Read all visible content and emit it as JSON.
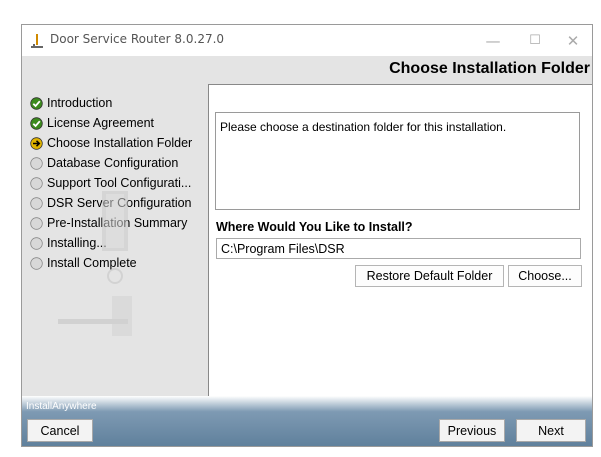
{
  "window": {
    "title": "Door Service Router 8.0.27.0",
    "controls": {
      "minimize": "—",
      "maximize": "☐",
      "close": "✕"
    }
  },
  "page_title": "Choose Installation Folder",
  "steps": [
    {
      "label": "Introduction",
      "status": "done",
      "icon": "check-circle-icon"
    },
    {
      "label": "License Agreement",
      "status": "done",
      "icon": "check-circle-icon"
    },
    {
      "label": "Choose Installation Folder",
      "status": "current",
      "icon": "arrow-circle-icon"
    },
    {
      "label": "Database Configuration",
      "status": "pending",
      "icon": "empty-circle-icon"
    },
    {
      "label": "Support Tool Configurati...",
      "status": "pending",
      "icon": "empty-circle-icon"
    },
    {
      "label": "DSR Server Configuration",
      "status": "pending",
      "icon": "empty-circle-icon"
    },
    {
      "label": "Pre-Installation Summary",
      "status": "pending",
      "icon": "empty-circle-icon"
    },
    {
      "label": "Installing...",
      "status": "pending",
      "icon": "empty-circle-icon"
    },
    {
      "label": "Install Complete",
      "status": "pending",
      "icon": "empty-circle-icon"
    }
  ],
  "content": {
    "description": "Please choose a destination folder for this installation.",
    "install_label": "Where Would You Like to Install?",
    "install_path": "C:\\Program Files\\DSR",
    "restore_button": "Restore Default Folder",
    "choose_button": "Choose..."
  },
  "footer": {
    "brand": "InstallAnywhere",
    "cancel": "Cancel",
    "previous": "Previous",
    "next": "Next"
  },
  "colors": {
    "done": "#3c8a1e",
    "current": "#e0b400",
    "pending": "#d8d8d8"
  }
}
